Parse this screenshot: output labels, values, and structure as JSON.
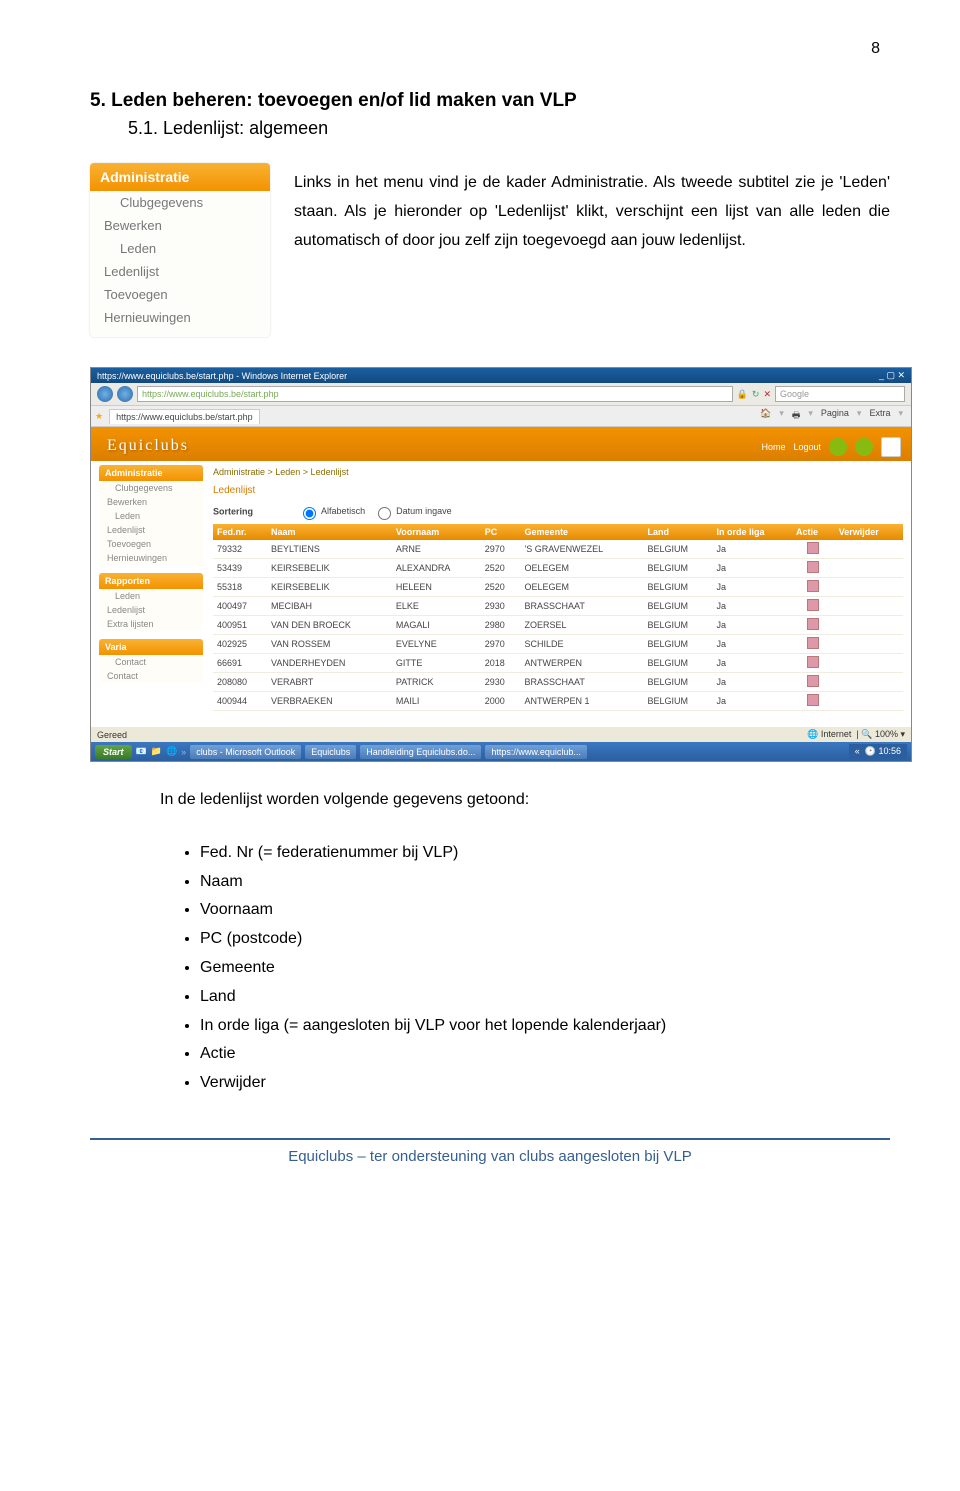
{
  "page_number": "8",
  "heading": "5.  Leden beheren: toevoegen en/of lid maken van VLP",
  "subheading": "5.1.  Ledenlijst: algemeen",
  "admin_menu": {
    "header": "Administratie",
    "items": [
      "Clubgegevens",
      "Bewerken",
      "Leden",
      "Ledenlijst",
      "Toevoegen",
      "Hernieuwingen"
    ]
  },
  "intro_text": "Links in het menu vind je de kader Administratie. Als tweede subtitel zie je 'Leden' staan. Als je hieronder op 'Ledenlijst' klikt, verschijnt een lijst van alle leden die automatisch of door jou zelf zijn toegevoegd aan jouw ledenlijst.",
  "screenshot": {
    "window_title": "https://www.equiclubs.be/start.php - Windows Internet Explorer",
    "url": "https://www.equiclubs.be/start.php",
    "search_placeholder": "Google",
    "tab_title": "https://www.equiclubs.be/start.php",
    "toolbar": {
      "pagina": "Pagina",
      "extra": "Extra"
    },
    "brand": "Equiclubs",
    "topright": {
      "home": "Home",
      "logout": "Logout"
    },
    "sidebar": {
      "box1": {
        "header": "Administratie",
        "items": [
          "Clubgegevens",
          "Bewerken",
          "Leden",
          "Ledenlijst",
          "Toevoegen",
          "Hernieuwingen"
        ]
      },
      "box2": {
        "header": "Rapporten",
        "items": [
          "Leden",
          "Ledenlijst",
          "Extra lijsten"
        ]
      },
      "box3": {
        "header": "Varia",
        "items": [
          "Contact",
          "Contact"
        ]
      }
    },
    "breadcrumb": "Administratie > Leden > Ledenlijst",
    "section_title": "Ledenlijst",
    "sort_label": "Sortering",
    "sort_options": [
      "Alfabetisch",
      "Datum ingave"
    ],
    "table": {
      "headers": [
        "Fed.nr.",
        "Naam",
        "Voornaam",
        "PC",
        "Gemeente",
        "Land",
        "In orde liga",
        "Actie",
        "Verwijder"
      ],
      "rows": [
        [
          "79332",
          "BEYLTIENS",
          "ARNE",
          "2970",
          "'S GRAVENWEZEL",
          "BELGIUM",
          "Ja"
        ],
        [
          "53439",
          "KEIRSEBELIK",
          "ALEXANDRA",
          "2520",
          "OELEGEM",
          "BELGIUM",
          "Ja"
        ],
        [
          "55318",
          "KEIRSEBELIK",
          "HELEEN",
          "2520",
          "OELEGEM",
          "BELGIUM",
          "Ja"
        ],
        [
          "400497",
          "MECIBAH",
          "ELKE",
          "2930",
          "BRASSCHAAT",
          "BELGIUM",
          "Ja"
        ],
        [
          "400951",
          "VAN DEN BROECK",
          "MAGALI",
          "2980",
          "ZOERSEL",
          "BELGIUM",
          "Ja"
        ],
        [
          "402925",
          "VAN ROSSEM",
          "EVELYNE",
          "2970",
          "SCHILDE",
          "BELGIUM",
          "Ja"
        ],
        [
          "66691",
          "VANDERHEYDEN",
          "GITTE",
          "2018",
          "ANTWERPEN",
          "BELGIUM",
          "Ja"
        ],
        [
          "208080",
          "VERABRT",
          "PATRICK",
          "2930",
          "BRASSCHAAT",
          "BELGIUM",
          "Ja"
        ],
        [
          "400944",
          "VERBRAEKEN",
          "MAILI",
          "2000",
          "ANTWERPEN 1",
          "BELGIUM",
          "Ja"
        ]
      ]
    },
    "status": {
      "left": "Gereed",
      "right_net": "Internet",
      "zoom": "100%"
    },
    "taskbar": {
      "start": "Start",
      "buttons": [
        "clubs - Microsoft Outlook",
        "Equiclubs",
        "Handleiding Equiclubs.do...",
        "https://www.equiclub..."
      ],
      "time": "10:56"
    }
  },
  "after_text": "In de ledenlijst worden volgende gegevens getoond:",
  "bullets": [
    "Fed. Nr (= federatienummer bij VLP)",
    "Naam",
    "Voornaam",
    "PC (postcode)",
    "Gemeente",
    "Land",
    "In orde liga (= aangesloten bij VLP voor het lopende kalenderjaar)",
    "Actie",
    "Verwijder"
  ],
  "footer": "Equiclubs – ter ondersteuning van clubs aangesloten bij VLP"
}
